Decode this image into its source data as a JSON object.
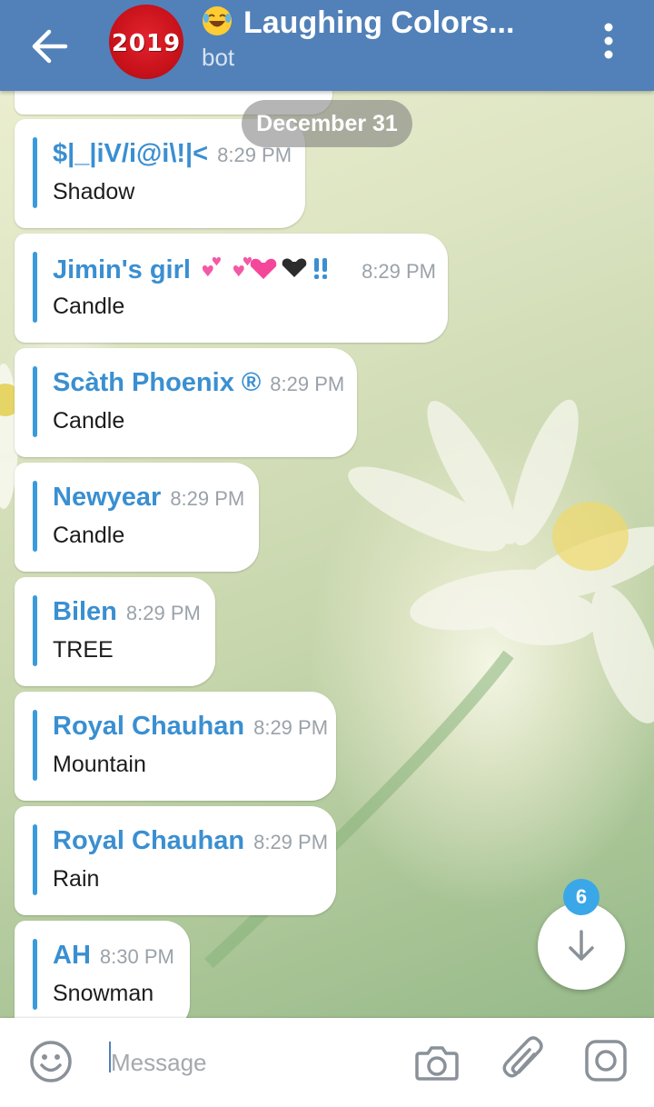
{
  "header": {
    "title": "Laughing Colors...",
    "subtitle": "bot",
    "avatar_text": "2019",
    "back_icon": "arrow-left-icon",
    "menu_icon": "more-vertical-icon",
    "title_emoji_icon": "laughing-emoji-icon"
  },
  "date_chip": "December 31",
  "messages": [
    {
      "author": "$|_|iV/i@i\\!|<",
      "time": "8:29 PM",
      "text": "Shadow"
    },
    {
      "author": "Jimin's girl",
      "time": "8:29 PM",
      "text": "Candle",
      "emoji_icons": [
        "two-hearts-icon",
        "two-hearts-icon",
        "sparkling-heart-icon",
        "black-heart-icon",
        "double-exclamation-icon"
      ]
    },
    {
      "author": "Scàth Phoenix ®",
      "time": "8:29 PM",
      "text": "Candle"
    },
    {
      "author": "Newyear",
      "time": "8:29 PM",
      "text": "Candle"
    },
    {
      "author": "Bilen",
      "time": "8:29 PM",
      "text": "TREE"
    },
    {
      "author": "Royal Chauhan",
      "time": "8:29 PM",
      "text": "Mountain"
    },
    {
      "author": "Royal Chauhan",
      "time": "8:29 PM",
      "text": "Rain"
    },
    {
      "author": "AH",
      "time": "8:30 PM",
      "text": "Snowman"
    }
  ],
  "scroll_button": {
    "icon": "arrow-down-icon",
    "unread_count": "6"
  },
  "input_bar": {
    "placeholder": "Message",
    "value": "",
    "emoji_icon": "smiley-icon",
    "camera_icon": "camera-icon",
    "attach_icon": "paperclip-icon",
    "instagram_icon": "instagram-icon"
  },
  "colors": {
    "header": "#5181b8",
    "author": "#3a8fd1",
    "accent_bar": "#3a9bdc",
    "badge": "#3aa7e8"
  }
}
